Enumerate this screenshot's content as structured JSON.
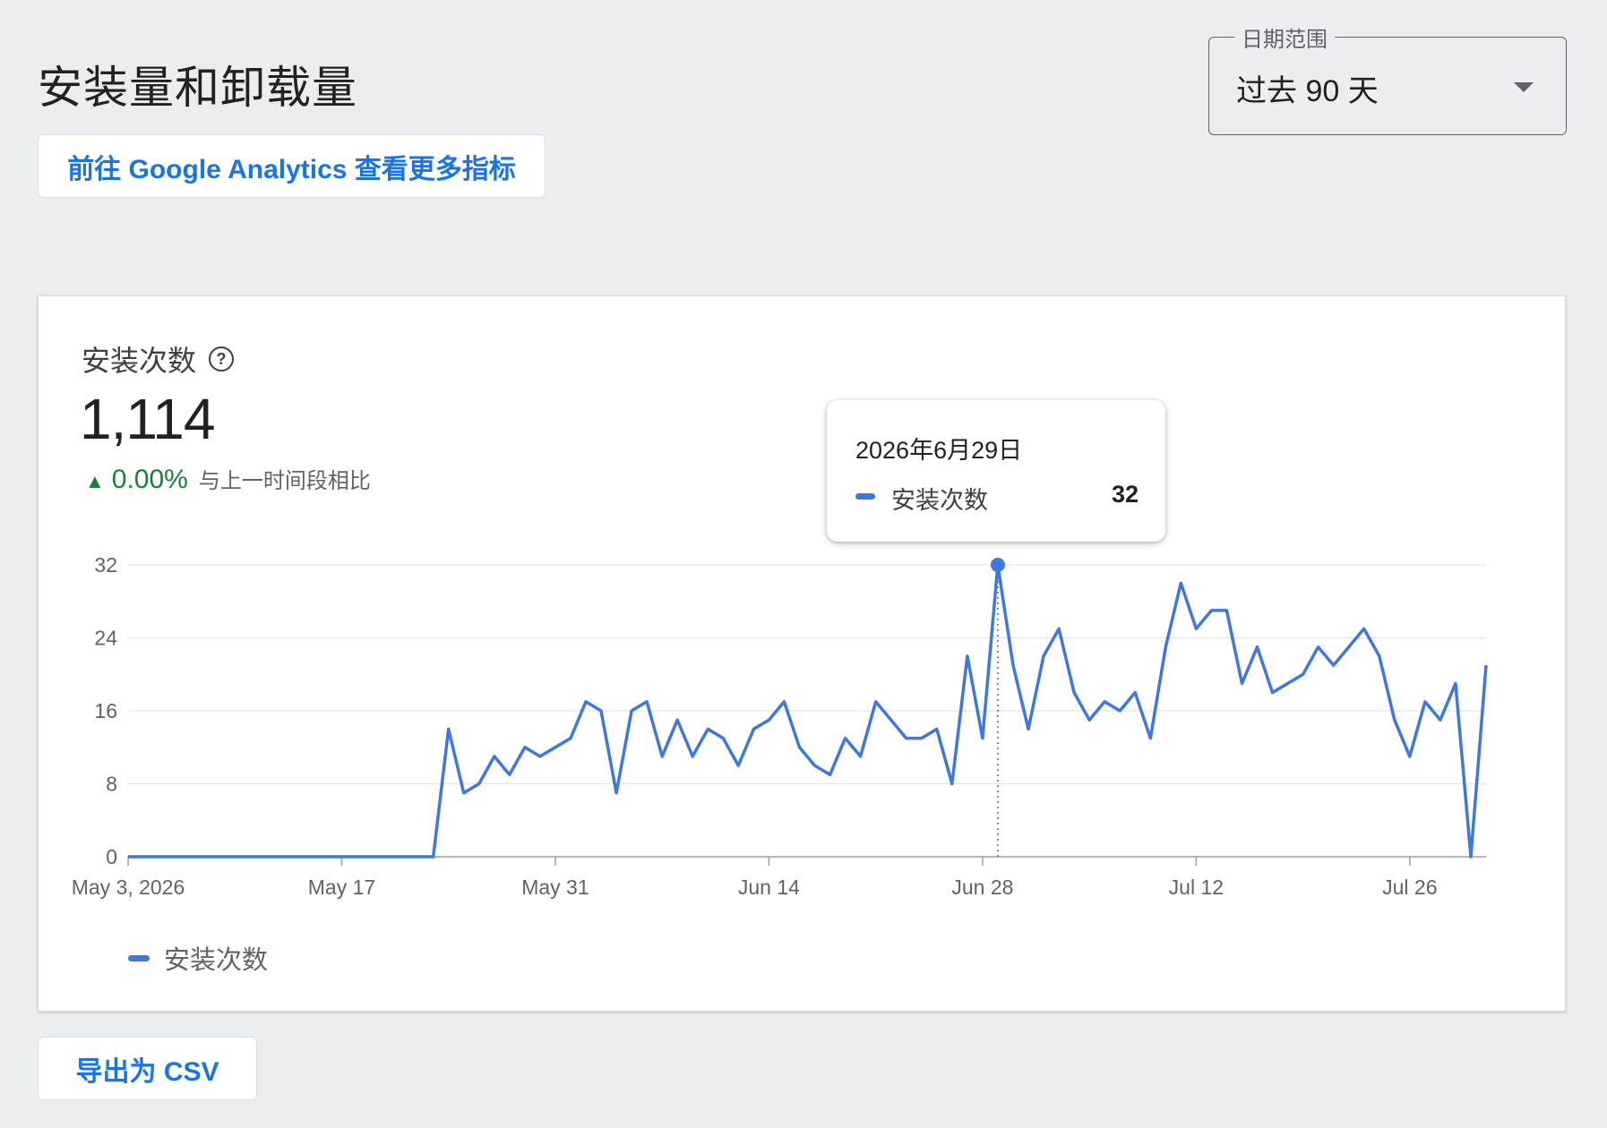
{
  "page": {
    "title": "安装量和卸载量",
    "ga_button_label": "前往 Google Analytics 查看更多指标",
    "export_button_label": "导出为 CSV"
  },
  "date_range": {
    "label": "日期范围",
    "value": "过去 90 天"
  },
  "metric": {
    "title": "安装次数",
    "help_icon": "help-circle-icon",
    "value": "1,114",
    "delta_icon": "arrow-up-icon",
    "delta": "0.00%",
    "delta_caption": "与上一时间段相比",
    "delta_color": "#188038"
  },
  "tooltip": {
    "date": "2026年6月29日",
    "series": "安装次数",
    "value": "32"
  },
  "legend": {
    "label": "安装次数"
  },
  "colors": {
    "accent": "#1a73e8",
    "series": "#3c78e0"
  },
  "chart_data": {
    "type": "line",
    "start_date": "2026-05-03",
    "x_tick_labels": [
      "May 3, 2026",
      "May 17",
      "May 31",
      "Jun 14",
      "Jun 28",
      "Jul 12",
      "Jul 26"
    ],
    "y_ticks": [
      0,
      8,
      16,
      24,
      32
    ],
    "ylim": [
      0,
      32
    ],
    "grid": true,
    "legend_position": "bottom-left",
    "highlight": {
      "date": "2026-06-29",
      "value": 32
    },
    "series": [
      {
        "name": "安装次数",
        "values": [
          0,
          0,
          0,
          0,
          0,
          0,
          0,
          0,
          0,
          0,
          0,
          0,
          0,
          0,
          0,
          0,
          0,
          0,
          0,
          0,
          0,
          14,
          7,
          8,
          11,
          9,
          12,
          11,
          12,
          13,
          17,
          16,
          7,
          16,
          17,
          11,
          15,
          11,
          14,
          13,
          10,
          14,
          15,
          17,
          12,
          10,
          9,
          13,
          11,
          17,
          15,
          13,
          13,
          14,
          8,
          22,
          13,
          32,
          21,
          14,
          22,
          25,
          18,
          15,
          17,
          16,
          18,
          13,
          23,
          30,
          25,
          27,
          27,
          19,
          23,
          18,
          19,
          20,
          23,
          21,
          23,
          25,
          22,
          15,
          11,
          17,
          15,
          19,
          0,
          21
        ]
      }
    ]
  }
}
